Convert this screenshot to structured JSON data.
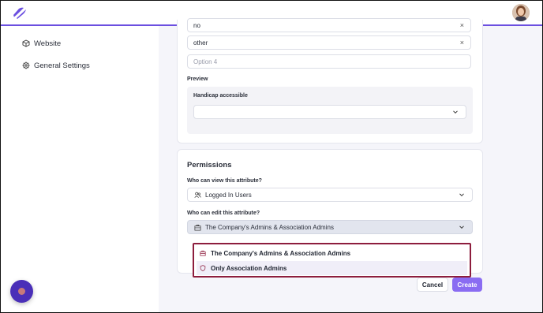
{
  "sidebar": {
    "items": [
      {
        "label": "Website",
        "icon": "cube-icon"
      },
      {
        "label": "General Settings",
        "icon": "gear-icon"
      }
    ]
  },
  "options_card": {
    "options": [
      {
        "value": "no"
      },
      {
        "value": "other"
      }
    ],
    "new_option_placeholder": "Option 4",
    "remove_glyph": "×",
    "preview_label": "Preview",
    "preview_field_label": "Handicap accessible"
  },
  "permissions": {
    "title": "Permissions",
    "view_label": "Who can view this attribute?",
    "view_value": "Logged In Users",
    "edit_label": "Who can edit this attribute?",
    "edit_value": "The Company's Admins & Association Admins",
    "edit_options": [
      {
        "label": "The Company's Admins & Association Admins",
        "icon": "building-icon"
      },
      {
        "label": "Only Association Admins",
        "icon": "shield-icon"
      }
    ]
  },
  "actions": {
    "cancel_label": "Cancel",
    "create_label": "Create"
  },
  "colors": {
    "accent": "#6b4fe0",
    "create_button": "#8a6cf2",
    "dropdown_outline": "#8d1d3d"
  }
}
